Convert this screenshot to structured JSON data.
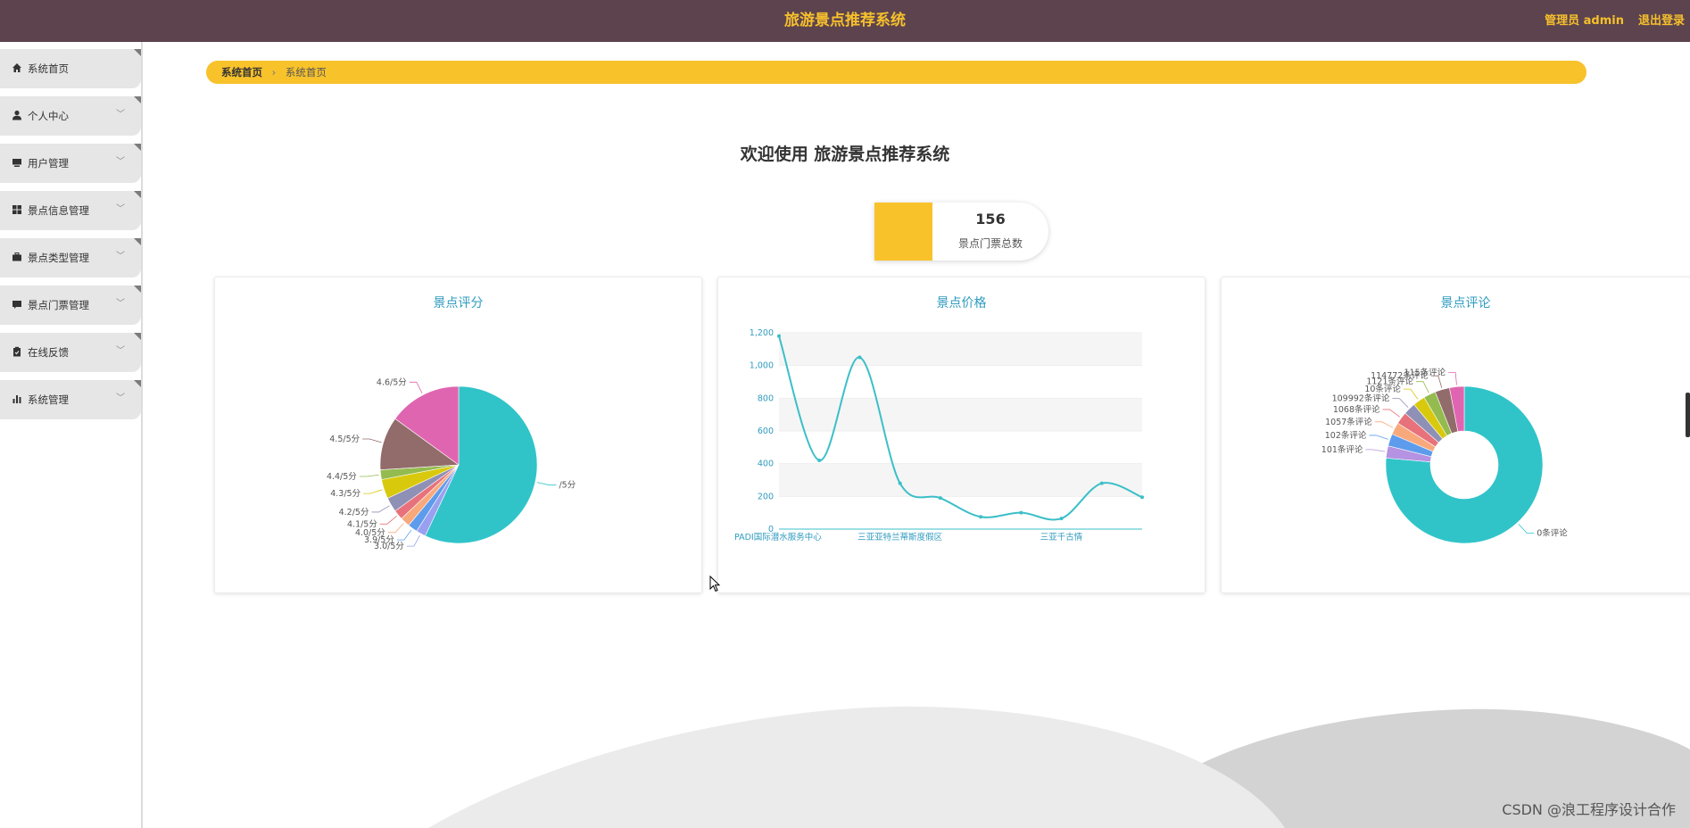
{
  "app": {
    "title": "旅游景点推荐系统",
    "admin": "管理员 admin",
    "logout": "退出登录"
  },
  "sidebar": {
    "items": [
      {
        "label": "系统首页",
        "icon": "home-icon",
        "expandable": false
      },
      {
        "label": "个人中心",
        "icon": "user-icon",
        "expandable": true
      },
      {
        "label": "用户管理",
        "icon": "monitor-icon",
        "expandable": true
      },
      {
        "label": "景点信息管理",
        "icon": "grid-icon",
        "expandable": true
      },
      {
        "label": "景点类型管理",
        "icon": "briefcase-icon",
        "expandable": true
      },
      {
        "label": "景点门票管理",
        "icon": "ticket-icon",
        "expandable": true
      },
      {
        "label": "在线反馈",
        "icon": "clipboard-icon",
        "expandable": true
      },
      {
        "label": "系统管理",
        "icon": "bar-chart-icon",
        "expandable": true
      }
    ]
  },
  "breadcrumb": {
    "home": "系统首页",
    "separator": "›",
    "current": "系统首页"
  },
  "welcome": "欢迎使用 旅游景点推荐系统",
  "stat": {
    "value": "156",
    "label": "景点门票总数"
  },
  "cards": {
    "rating_title": "景点评分",
    "price_title": "景点价格",
    "comment_title": "景点评论"
  },
  "watermark": "CSDN @浪工程序设计合作",
  "colors": {
    "topbar": "#5c434e",
    "accent": "#f8c22b",
    "title_blue": "#2f9bbf"
  },
  "chart_data": [
    {
      "type": "pie",
      "title": "景点评分",
      "labels": [
        "/5分",
        "3.0/5分",
        "3.9/5分",
        "4.0/5分",
        "4.1/5分",
        "4.2/5分",
        "4.3/5分",
        "4.4/5分",
        "4.5/5分",
        "4.6/5分"
      ],
      "values": [
        57,
        2,
        2,
        2,
        2,
        3,
        4,
        2,
        11,
        15
      ],
      "colors": [
        "#30c4c9",
        "#9aa0f0",
        "#5d9cec",
        "#f8a97c",
        "#e7727b",
        "#8f90b5",
        "#d9c90d",
        "#94bb4f",
        "#926c6a",
        "#e065b1"
      ]
    },
    {
      "type": "line",
      "title": "景点价格",
      "categories": [
        "PADI国际潜水服务中心",
        "",
        "",
        "三亚亚特兰蒂斯度假区",
        "",
        "",
        "",
        "三亚千古情",
        ""
      ],
      "values": [
        1180,
        420,
        1050,
        280,
        190,
        75,
        100,
        65,
        280,
        195
      ],
      "x_tick_labels": [
        "PADI国际潜水服务中心",
        "三亚亚特兰蒂斯度假区",
        "三亚千古情"
      ],
      "y_ticks": [
        "0",
        "200",
        "400",
        "600",
        "800",
        "1,000",
        "1,200"
      ],
      "ylim": [
        0,
        1200
      ],
      "smooth": true,
      "color": "#3bbfc8"
    },
    {
      "type": "pie",
      "title": "景点评论",
      "donut": true,
      "labels": [
        "0条评论",
        "101条评论",
        "102条评论",
        "1057条评论",
        "1068条评论",
        "109992条评论",
        "10条评论",
        "1121条评论",
        "114772条评论",
        "115条评论"
      ],
      "values": [
        76,
        2.5,
        2.5,
        2.5,
        2.5,
        2.5,
        2.5,
        2.5,
        3,
        3
      ],
      "colors": [
        "#30c4c9",
        "#b592e2",
        "#5d9cec",
        "#f8a97c",
        "#e7727b",
        "#8f90b5",
        "#d9c90d",
        "#94bb4f",
        "#926c6a",
        "#e065b1"
      ]
    }
  ]
}
